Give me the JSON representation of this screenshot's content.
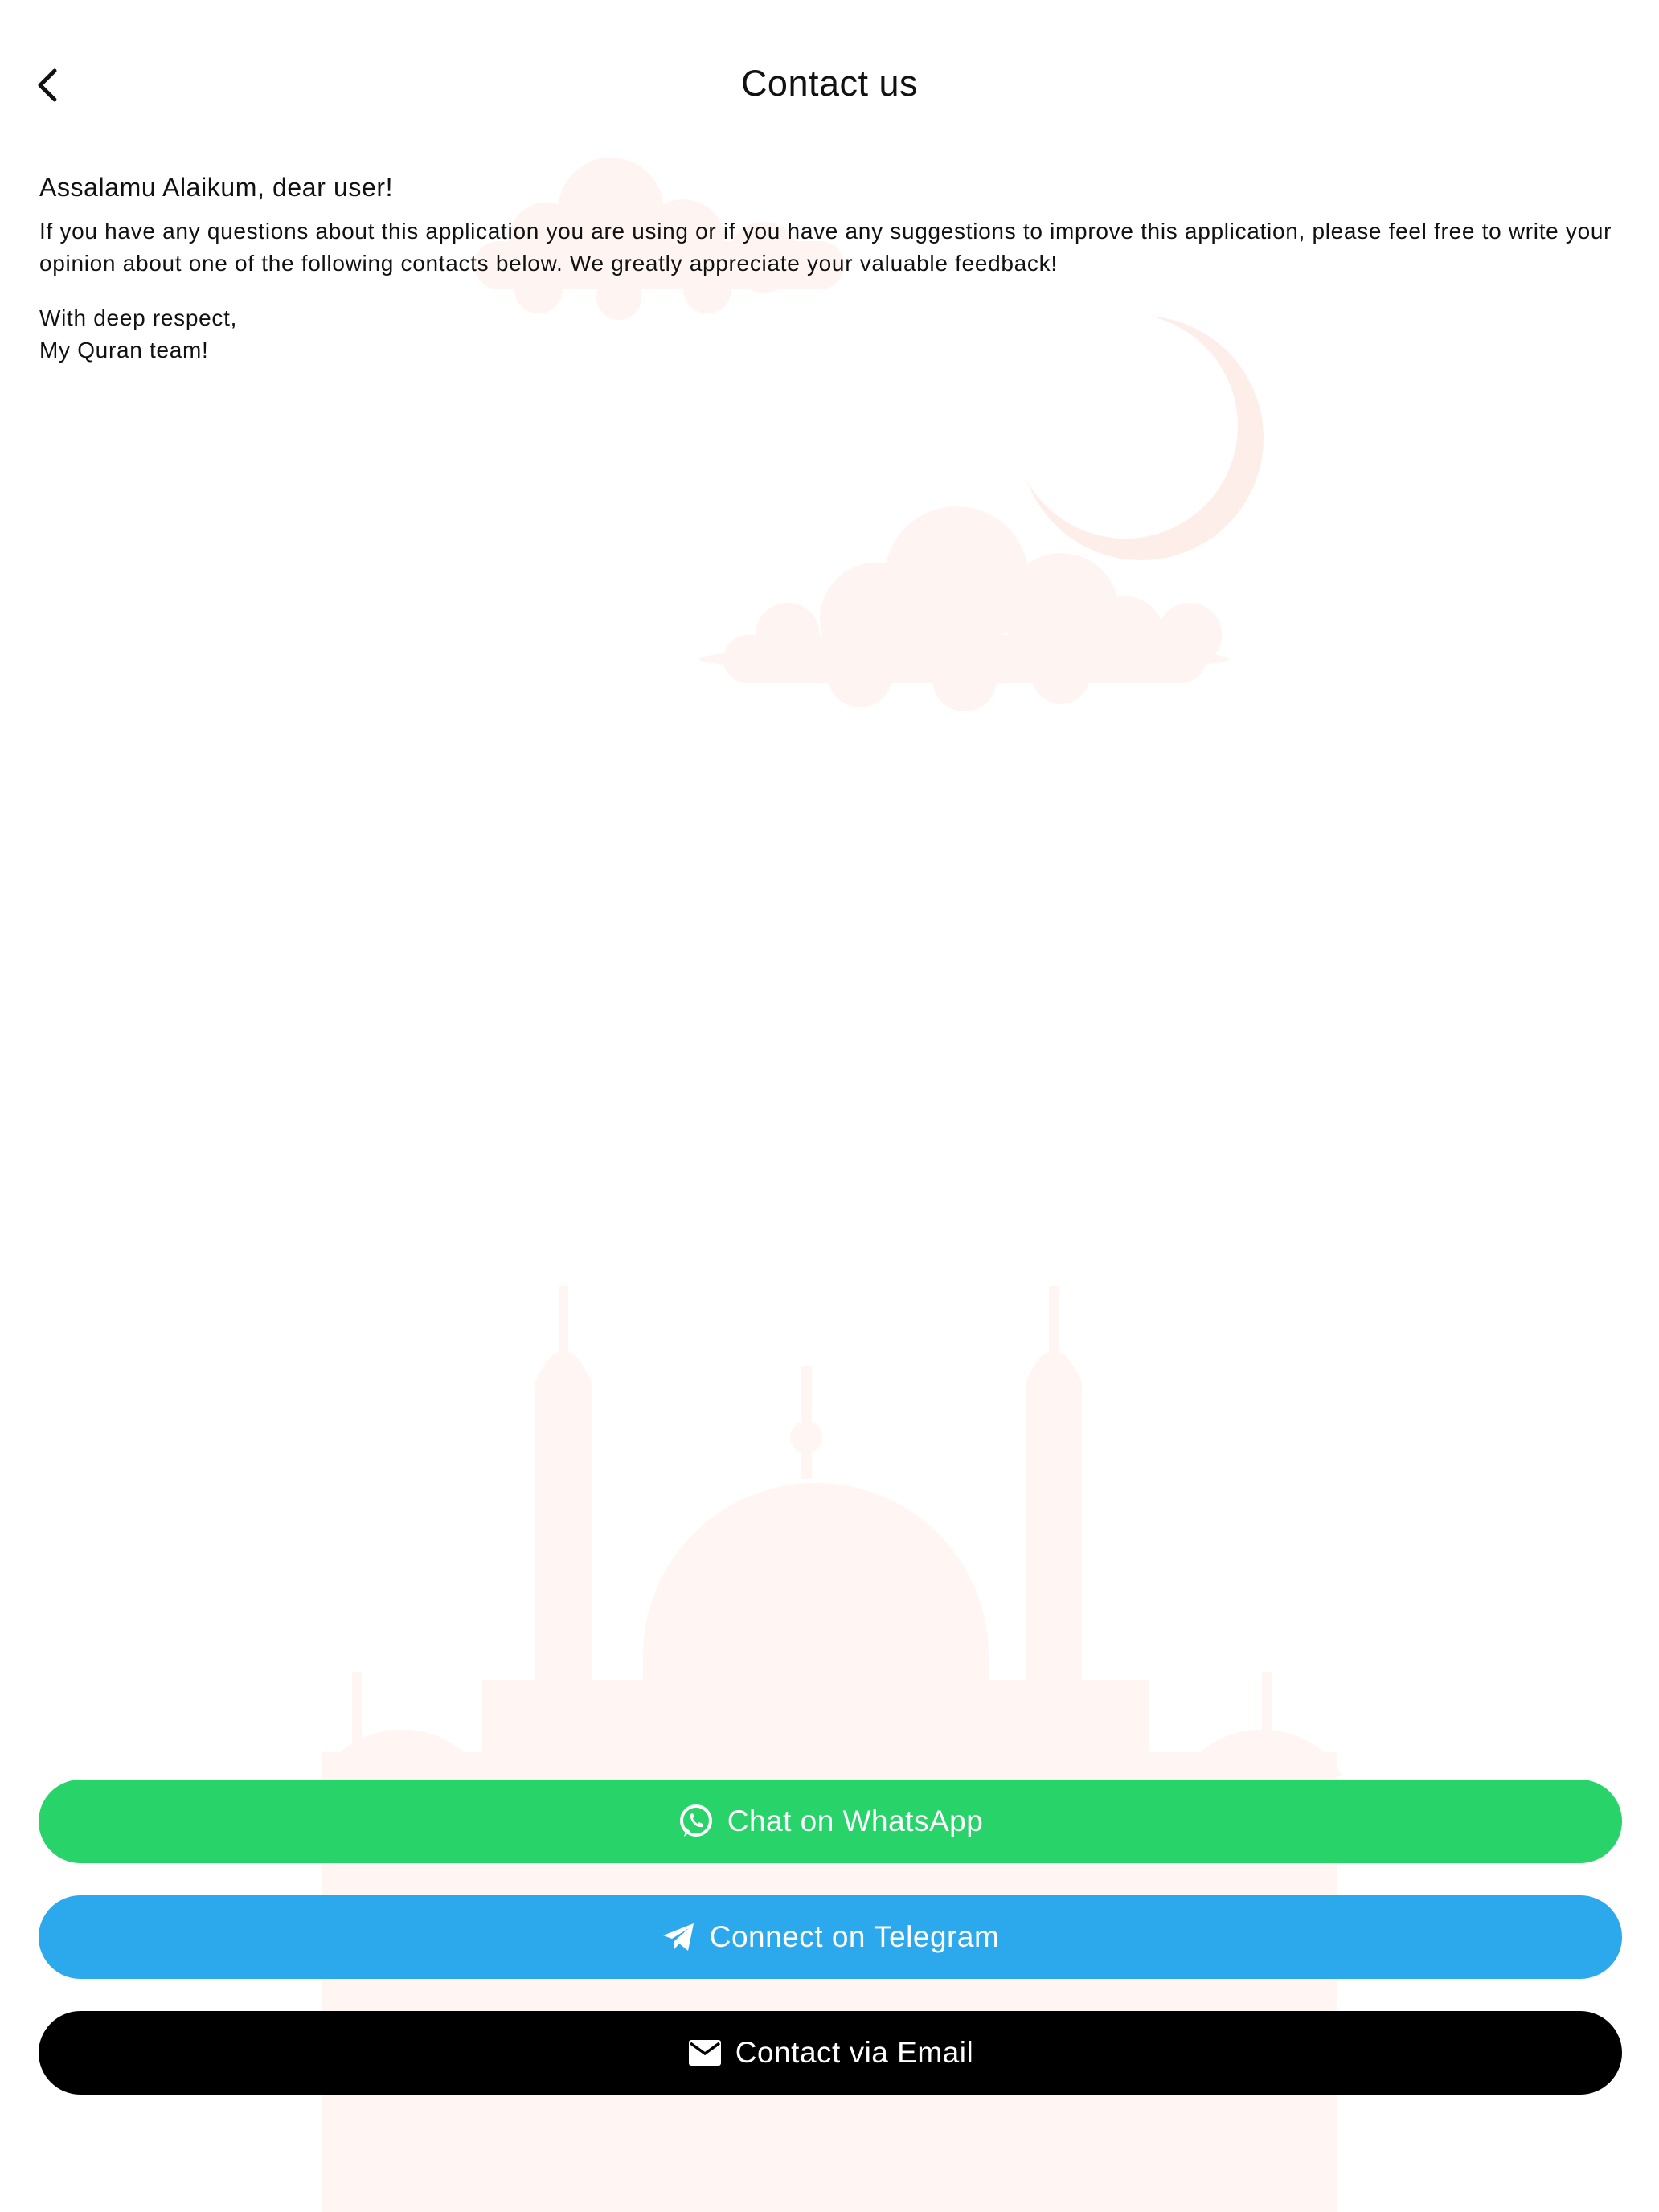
{
  "header": {
    "back_icon": "chevron-left-icon",
    "title": "Contact us"
  },
  "message": {
    "greeting": "Assalamu Alaikum, dear user!",
    "body": "If you have any questions about this application you are using or if you have any suggestions to improve this application, please feel free to write your opinion about one of the following contacts below. We greatly appreciate your valuable feedback!",
    "signoff_line1": "With deep respect,",
    "signoff_line2": "My Quran team!"
  },
  "buttons": {
    "whatsapp": {
      "label": "Chat on WhatsApp",
      "icon": "whatsapp-icon",
      "color": "#28D369"
    },
    "telegram": {
      "label": "Connect on Telegram",
      "icon": "telegram-icon",
      "color": "#2CA9EC"
    },
    "email": {
      "label": "Contact via Email",
      "icon": "mail-icon",
      "color": "#000000"
    }
  },
  "background": {
    "art_color": "#FDF4F1"
  }
}
